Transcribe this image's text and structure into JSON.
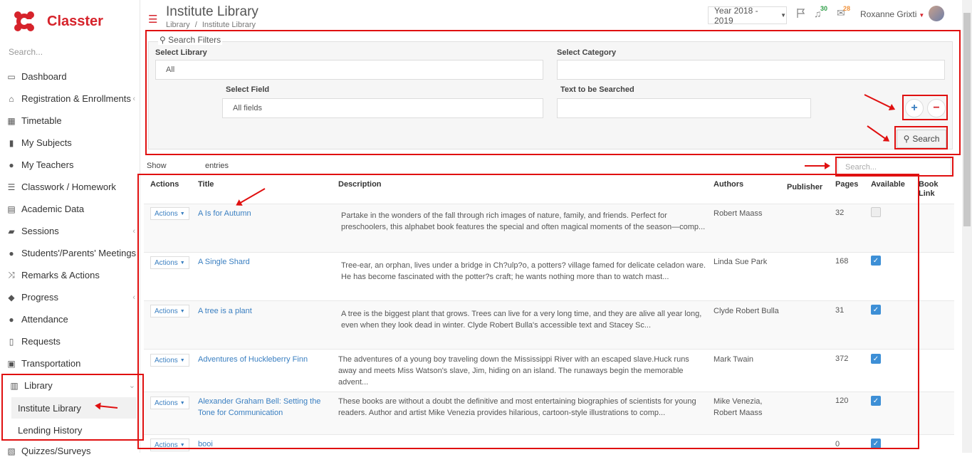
{
  "brand": {
    "name": "Classter"
  },
  "sidebar": {
    "search_placeholder": "Search...",
    "items": [
      {
        "label": "Dashboard",
        "icon": "laptop-icon"
      },
      {
        "label": "Registration & Enrollments",
        "icon": "institution-icon"
      },
      {
        "label": "Timetable",
        "icon": "calendar-icon"
      },
      {
        "label": "My Subjects",
        "icon": "book-icon"
      },
      {
        "label": "My Teachers",
        "icon": "users-icon"
      },
      {
        "label": "Classwork / Homework",
        "icon": "list-icon"
      },
      {
        "label": "Academic Data",
        "icon": "report-icon"
      },
      {
        "label": "Sessions",
        "icon": "presentation-icon"
      },
      {
        "label": "Students'/Parents' Meetings",
        "icon": "meeting-icon"
      },
      {
        "label": "Remarks & Actions",
        "icon": "shuffle-icon"
      },
      {
        "label": "Progress",
        "icon": "graduation-cap-icon"
      },
      {
        "label": "Attendance",
        "icon": "user-check-icon"
      },
      {
        "label": "Requests",
        "icon": "document-icon"
      },
      {
        "label": "Transportation",
        "icon": "bus-icon"
      },
      {
        "label": "Library",
        "icon": "library-icon"
      },
      {
        "label": "Quizzes/Surveys",
        "icon": "quiz-icon"
      }
    ],
    "library_sub": [
      "Institute Library",
      "Lending History"
    ]
  },
  "header": {
    "title": "Institute Library",
    "breadcrumb": [
      "Library",
      "Institute Library"
    ],
    "breadcrumb_sep": "/",
    "year": "Year 2018 - 2019",
    "notifications_count": "30",
    "messages_count": "28",
    "user_name": "Roxanne Grixti"
  },
  "filters": {
    "legend": "Search Filters",
    "select_library_label": "Select Library",
    "select_library_value": "All",
    "select_category_label": "Select Category",
    "select_category_value": "",
    "select_field_label": "Select Field",
    "select_field_value": "All fields",
    "text_search_label": "Text to be Searched",
    "text_search_value": "",
    "plus": "+",
    "minus": "−",
    "search_button": "Search"
  },
  "table_controls": {
    "show": "Show",
    "entries": "entries",
    "search_placeholder": "Search..."
  },
  "table": {
    "columns": [
      "Actions",
      "Title",
      "Description",
      "Authors",
      "Publisher",
      "Pages",
      "Available",
      "Book Link"
    ],
    "action_label": "Actions",
    "rows": [
      {
        "title": "A Is for Autumn",
        "description": "Partake in the wonders of the fall through rich images of nature, family, and friends. Perfect for preschoolers, this alphabet book features the special and often magical moments of the season—comp...",
        "authors": "Robert Maass",
        "pages": "32",
        "available": false
      },
      {
        "title": "A Single Shard",
        "description": "Tree-ear, an orphan, lives under a bridge in Ch?ulp?o, a potters? village famed for delicate celadon ware. He has become fascinated with the potter?s craft; he wants nothing more than to watch mast...",
        "authors": "Linda Sue Park",
        "pages": "168",
        "available": true
      },
      {
        "title": "A tree is a plant",
        "description": "A tree is the biggest plant that grows. Trees can live for a very long time, and they are alive all year long, even when they look dead in winter. Clyde Robert Bulla's accessible text and Stacey Sc...",
        "authors": "Clyde Robert Bulla",
        "pages": "31",
        "available": true
      },
      {
        "title": "Adventures of Huckleberry Finn",
        "description": "The adventures of a young boy traveling down the Mississippi River with an escaped slave.Huck runs away and meets Miss Watson's slave, Jim, hiding on an island. The runaways begin the memorable advent...",
        "authors": "Mark Twain",
        "pages": "372",
        "available": true
      },
      {
        "title": "Alexander Graham Bell: Setting the Tone for Communication",
        "description": "These books are without a doubt the definitive and most entertaining biographies of scientists for young readers. Author and artist Mike Venezia provides hilarious, cartoon-style illustrations to comp...",
        "authors": "Mike Venezia, Robert Maass",
        "pages": "120",
        "available": true
      },
      {
        "title": "booi",
        "description": "",
        "authors": "",
        "pages": "0",
        "available": true
      }
    ]
  },
  "colors": {
    "brand": "#d6232b",
    "link": "#3a7fc1",
    "annotation": "#e01010",
    "check": "#3d8fd6"
  }
}
